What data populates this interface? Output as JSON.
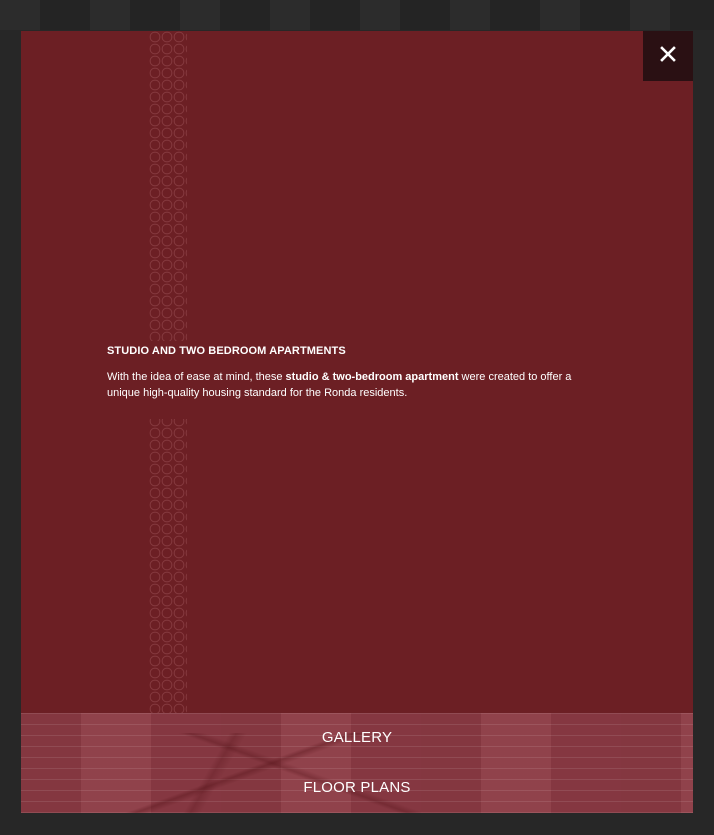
{
  "modal": {
    "heading": "STUDIO AND TWO BEDROOM APARTMENTS",
    "description_part1": "With the idea of ease at mind, these ",
    "description_bold": "studio & two-bedroom apartment",
    "description_part2": " were created to offer a unique high-quality housing standard for the Ronda residents.",
    "close_icon": "close-icon"
  },
  "footer": {
    "gallery_label": "GALLERY",
    "floor_plans_label": "FLOOR PLANS"
  },
  "colors": {
    "modal_background": "#6c1f24",
    "close_background": "#2a1013",
    "footer_background": "#8c3a44",
    "text": "#ffffff"
  }
}
